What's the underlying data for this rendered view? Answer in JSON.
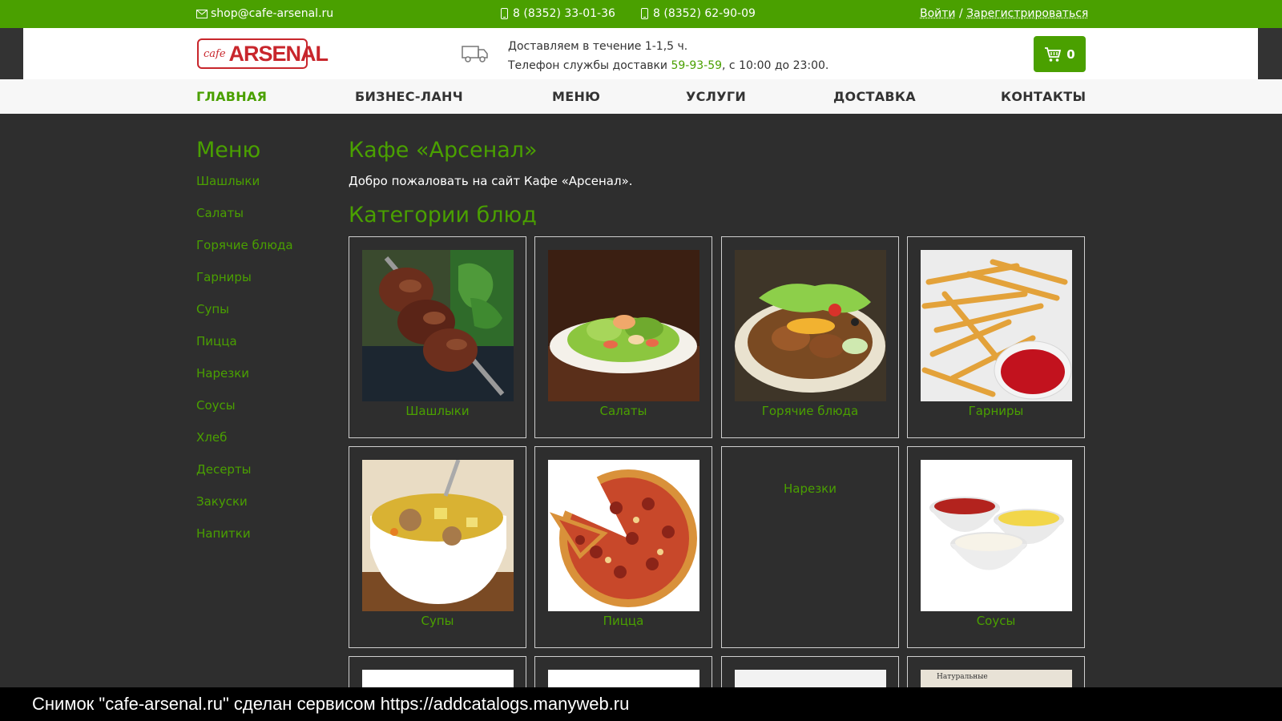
{
  "topbar": {
    "email": "shop@cafe-arsenal.ru",
    "phone1": "8 (8352) 33-01-36",
    "phone2": "8 (8352) 62-90-09",
    "login": "Войти",
    "separator": "/",
    "register": "Зарегистрироваться",
    "icons": [
      "mail-icon",
      "phone-icon"
    ]
  },
  "header": {
    "logo_cafe": "cafe",
    "logo_name": "ARSENAL",
    "delivery_line1": "Доставляем в течение 1-1,5 ч.",
    "delivery_line2_prefix": "Телефон службы доставки ",
    "delivery_phone": "59-93-59",
    "delivery_line2_suffix": ", с 10:00 до 23:00.",
    "cart_count": "0"
  },
  "nav": {
    "items": [
      "ГЛАВНАЯ",
      "БИЗНЕС-ЛАНЧ",
      "МЕНЮ",
      "УСЛУГИ",
      "ДОСТАВКА",
      "КОНТАКТЫ"
    ],
    "active": "ГЛАВНАЯ"
  },
  "sidebar": {
    "title": "Меню",
    "items": [
      "Шашлыки",
      "Салаты",
      "Горячие блюда",
      "Гарниры",
      "Супы",
      "Пицца",
      "Нарезки",
      "Соусы",
      "Хлеб",
      "Десерты",
      "Закуски",
      "Напитки"
    ]
  },
  "main": {
    "title": "Кафе «Арсенал»",
    "welcome": "Добро пожаловать на сайт Кафе «Арсенал».",
    "categories_title": "Категории блюд",
    "categories": [
      "Шашлыки",
      "Салаты",
      "Горячие блюда",
      "Гарниры",
      "Супы",
      "Пицца",
      "Нарезки",
      "Соусы"
    ],
    "partial_row_text": "Натуральные"
  },
  "caption": "Снимок \"cafe-arsenal.ru\" сделан сервисом https://addcatalogs.manyweb.ru",
  "colors": {
    "accent": "#4aa000",
    "background": "#2e2e2e",
    "brand_red": "#c8262c"
  }
}
